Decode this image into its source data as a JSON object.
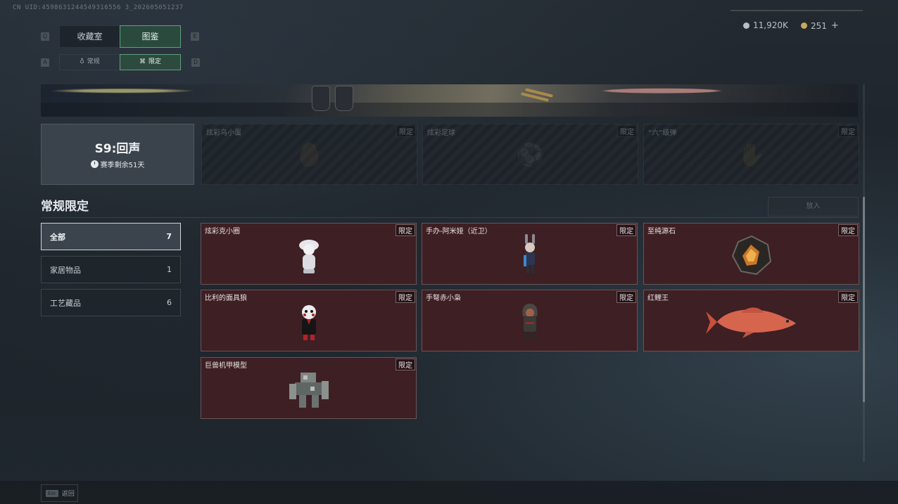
{
  "uid": "CN UID:4598631244549316556 3_202605051237",
  "top_tabs": {
    "key_left": "Q",
    "key_right": "E",
    "tabs": [
      "收藏室",
      "图鉴"
    ]
  },
  "sub_tabs": {
    "key_left": "A",
    "key_right": "D",
    "tabs": [
      "常规",
      "限定"
    ]
  },
  "currency": {
    "silver": "11,920K",
    "gold": "251",
    "add": "+"
  },
  "season": {
    "name": "S9:回声",
    "remain": "赛季剩余51天"
  },
  "locked_items": [
    {
      "name": "炫彩乌小蛋",
      "tag": "限定",
      "icon": "egg-silhouette"
    },
    {
      "name": "炫彩足球",
      "tag": "限定",
      "icon": "ball-silhouette"
    },
    {
      "name": "“六”级弹",
      "tag": "限定",
      "icon": "hand-silhouette"
    }
  ],
  "section": {
    "title": "常规限定",
    "put_button": "放入"
  },
  "categories": [
    {
      "label": "全部",
      "count": "7"
    },
    {
      "label": "家居物品",
      "count": "1"
    },
    {
      "label": "工艺藏品",
      "count": "6"
    }
  ],
  "items": [
    {
      "name": "炫彩克小圈",
      "tag": "限定",
      "icon": "figurine-icon"
    },
    {
      "name": "手办-阿米娅（近卫）",
      "tag": "限定",
      "icon": "anime-figure-icon"
    },
    {
      "name": "至纯源石",
      "tag": "限定",
      "icon": "crystal-icon"
    },
    {
      "name": "比利的面具狼",
      "tag": "限定",
      "icon": "puppet-icon"
    },
    {
      "name": "手弩赤小枭",
      "tag": "限定",
      "icon": "hooded-figure-icon"
    },
    {
      "name": "红鲤王",
      "tag": "限定",
      "icon": "carp-icon"
    },
    {
      "name": "巨兽机甲模型",
      "tag": "限定",
      "icon": "mech-model-icon"
    }
  ],
  "footer": {
    "key": "Esc",
    "label": "返回"
  },
  "colors": {
    "accent_green": "#5fa07f",
    "item_bg": "#3e1f24"
  }
}
